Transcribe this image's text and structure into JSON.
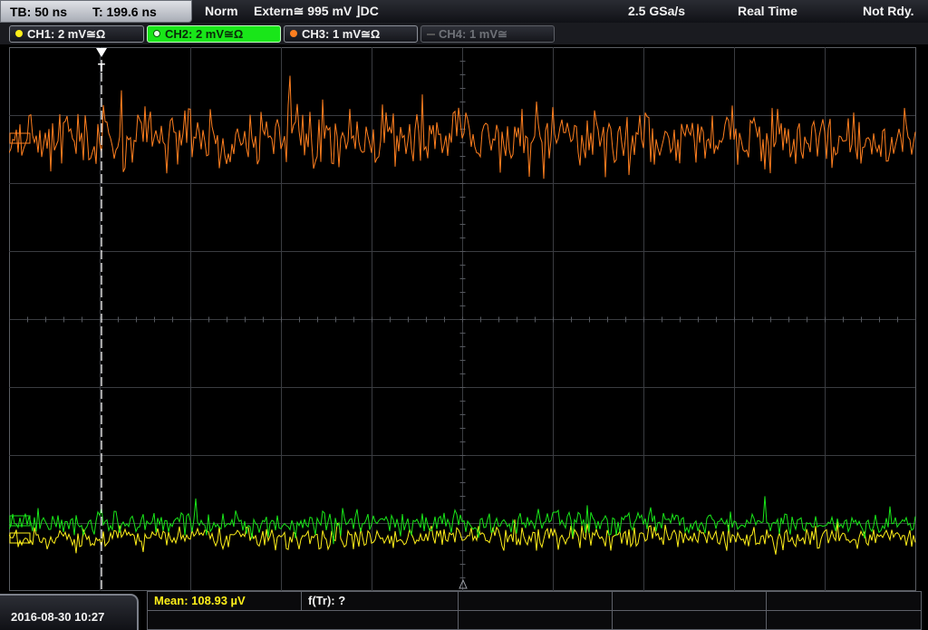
{
  "header": {
    "timebase": "TB: 50 ns",
    "trigger_time": "T: 199.6 ns",
    "mode": "Norm",
    "trigger_source": "Extern",
    "coupling_symbol": "≅",
    "trigger_level": "995 mV",
    "edge_symbol": "⌋",
    "trigger_coupling": "DC",
    "sample_rate": "2.5 GSa/s",
    "acquisition": "Real Time",
    "status": "Not Rdy."
  },
  "channels": [
    {
      "label": "CH1: 2 mV≅Ω",
      "color": "#ffef1a",
      "state": "on"
    },
    {
      "label": "CH2: 2 mV≅Ω",
      "color": "#19e619",
      "state": "active"
    },
    {
      "label": "CH3: 1 mV≅Ω",
      "color": "#ff7f1f",
      "state": "on"
    },
    {
      "label": "CH4: 1 mV≅",
      "color": "#666666",
      "state": "off"
    }
  ],
  "waveforms": {
    "ch1_color": "#ffef1a",
    "ch2_color": "#19e619",
    "ch3_color": "#ff7f1f"
  },
  "markers": {
    "trigger_marker": "T"
  },
  "footer": {
    "datetime": "2016-08-30 10:27",
    "measurement_1": "Mean: 108.93 µV",
    "measurement_2": "f(Tr): ?"
  }
}
